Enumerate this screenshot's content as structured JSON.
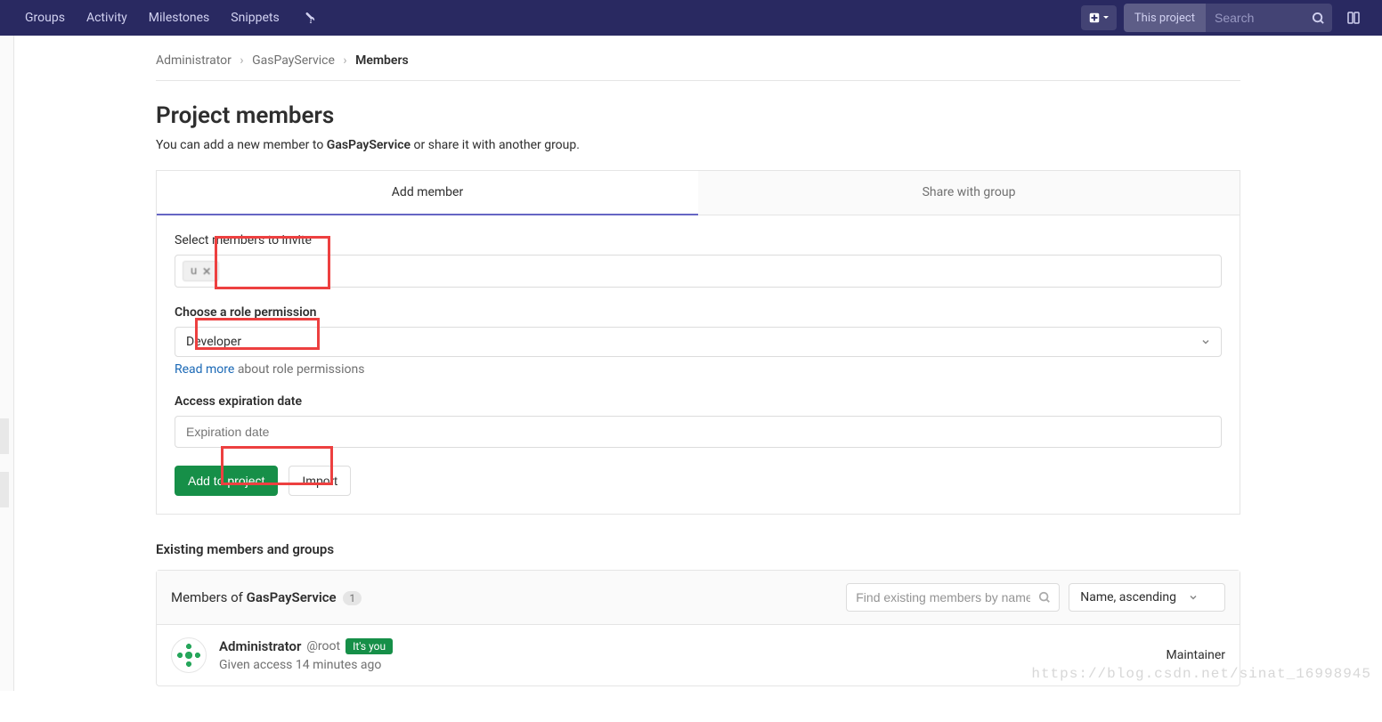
{
  "header": {
    "nav": [
      "Groups",
      "Activity",
      "Milestones",
      "Snippets"
    ],
    "search_scope": "This project",
    "search_placeholder": "Search"
  },
  "breadcrumb": {
    "root": "Administrator",
    "project": "GasPayService",
    "current": "Members"
  },
  "page": {
    "title": "Project members",
    "subtitle_before": "You can add a new member to ",
    "subtitle_project": "GasPayService",
    "subtitle_after": " or share it with another group."
  },
  "tabs": {
    "add_member": "Add member",
    "share_group": "Share with group"
  },
  "form": {
    "select_members_label": "Select members to invite",
    "chip_text": "    u",
    "role_label": "Choose a role permission",
    "role_value": "Developer",
    "help_link": "Read more",
    "help_rest": " about role permissions",
    "date_label": "Access expiration date",
    "date_placeholder": "Expiration date",
    "add_btn": "Add to project",
    "import_btn": "Import"
  },
  "existing": {
    "heading": "Existing members and groups",
    "panel_title_prefix": "Members of ",
    "panel_title_project": "GasPayService",
    "count": "1",
    "filter_placeholder": "Find existing members by name",
    "sort_value": "Name, ascending"
  },
  "member": {
    "name": "Administrator",
    "handle": "@root",
    "its_you": "It's you",
    "meta": "Given access 14 minutes ago",
    "role": "Maintainer"
  },
  "watermark": "https://blog.csdn.net/sinat_16998945"
}
